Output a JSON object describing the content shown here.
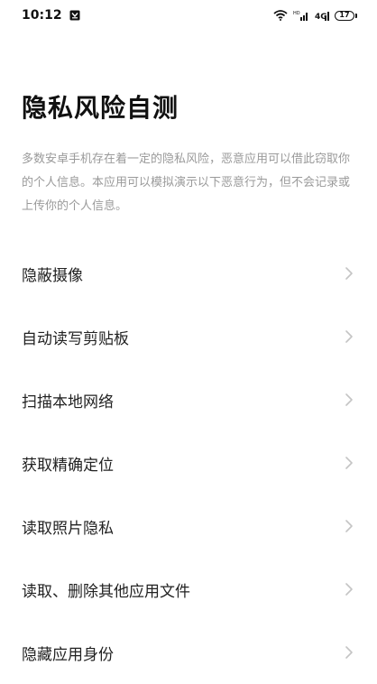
{
  "status_bar": {
    "time": "10:12",
    "battery_level": "17",
    "icons": [
      "notification-app-icon",
      "wifi-icon",
      "signal-icon",
      "hd-signal-icon",
      "battery-icon"
    ]
  },
  "page": {
    "title": "隐私风险自测",
    "description": "多数安卓手机存在着一定的隐私风险，恶意应用可以借此窃取你的个人信息。本应用可以模拟演示以下恶意行为，但不会记录或上传你的个人信息。"
  },
  "menu": {
    "items": [
      {
        "label": "隐蔽摄像"
      },
      {
        "label": "自动读写剪贴板"
      },
      {
        "label": "扫描本地网络"
      },
      {
        "label": "获取精确定位"
      },
      {
        "label": "读取照片隐私"
      },
      {
        "label": "读取、删除其他应用文件"
      },
      {
        "label": "隐藏应用身份"
      }
    ]
  },
  "colors": {
    "text_primary": "#111111",
    "text_secondary": "#9a9a9a",
    "chevron": "#c4c4c4",
    "background": "#ffffff"
  }
}
